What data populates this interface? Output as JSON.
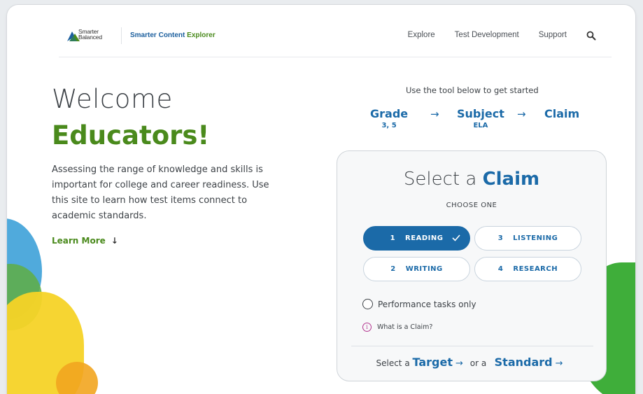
{
  "header": {
    "logo_line1": "Smarter",
    "logo_line2": "Balanced",
    "app_title_part1": "Smarter",
    "app_title_part2": "Content",
    "app_title_part3": "Explorer",
    "nav": [
      "Explore",
      "Test Development",
      "Support"
    ],
    "search_icon": "search-icon"
  },
  "hero": {
    "welcome": "Welcome",
    "educators": "Educators!",
    "intro": "Assessing the range of knowledge and skills is important for college and career readiness. Use this site to learn how test items connect to academic standards.",
    "learn_more": "Learn More",
    "learn_more_arrow": "↓"
  },
  "tool": {
    "caption": "Use the tool below to get started",
    "steps": [
      {
        "label": "Grade",
        "value": "3, 5"
      },
      {
        "label": "Subject",
        "value": "ELA"
      },
      {
        "label": "Claim",
        "value": ""
      }
    ],
    "step_arrow": "→"
  },
  "claim_card": {
    "title_prefix": "Select a",
    "title_emphasis": "Claim",
    "subtitle": "CHOOSE ONE",
    "options": [
      {
        "num": "1",
        "label": "READING",
        "selected": true
      },
      {
        "num": "3",
        "label": "LISTENING",
        "selected": false
      },
      {
        "num": "2",
        "label": "WRITING",
        "selected": false
      },
      {
        "num": "4",
        "label": "RESEARCH",
        "selected": false
      }
    ],
    "performance_tasks": "Performance tasks only",
    "what_is_claim": "What is a Claim?",
    "select_prefix": "Select a",
    "target": "Target",
    "or_a": "or a",
    "standard": "Standard",
    "arrow": "→"
  },
  "colors": {
    "brand_blue": "#1b6aa8",
    "brand_green": "#4a8a1c",
    "info_magenta": "#b3358f"
  }
}
